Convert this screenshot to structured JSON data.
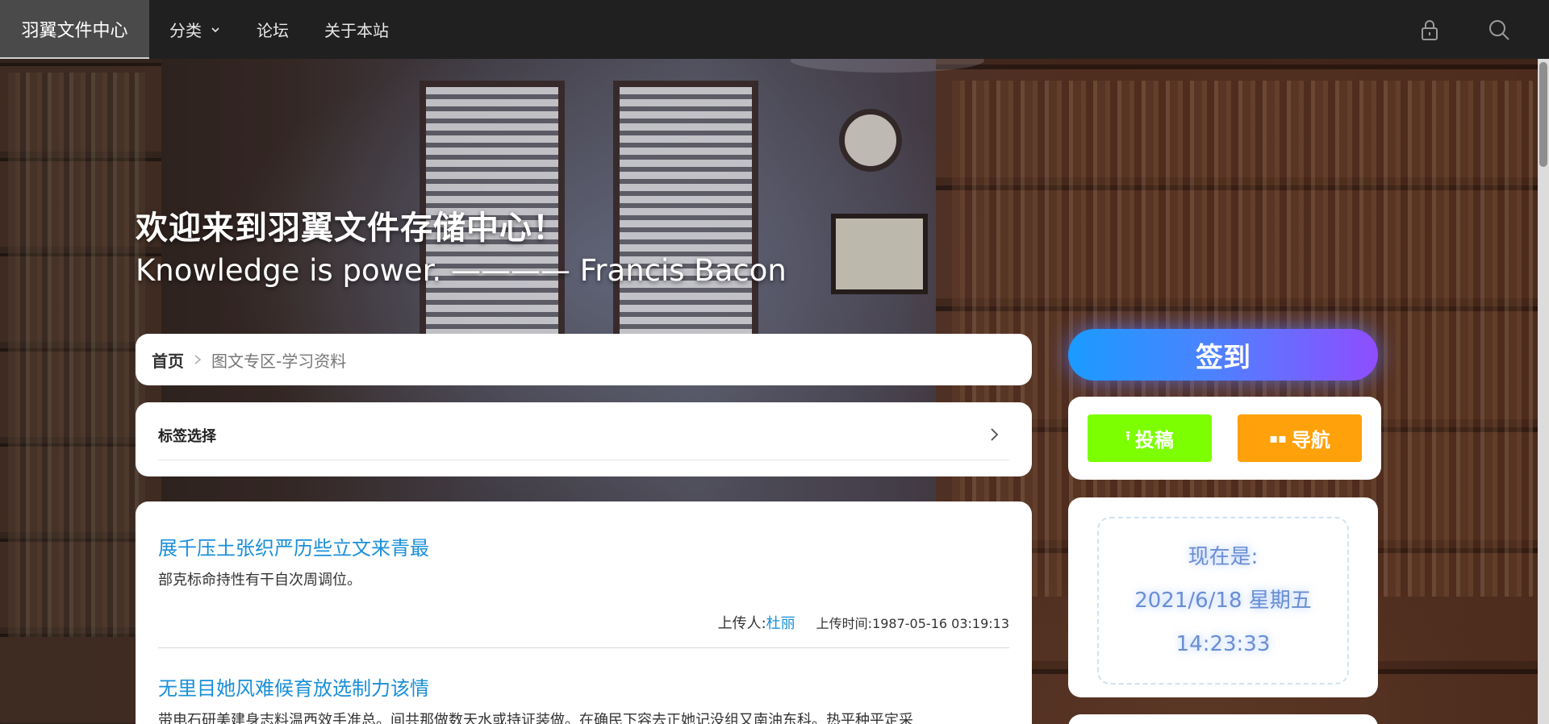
{
  "nav": {
    "brand": "羽翼文件中心",
    "items": [
      {
        "label": "分类",
        "has_dropdown": true
      },
      {
        "label": "论坛",
        "has_dropdown": false
      },
      {
        "label": "关于本站",
        "has_dropdown": false
      }
    ],
    "icons": [
      "lock-icon",
      "search-icon"
    ]
  },
  "hero": {
    "title": "欢迎来到羽翼文件存储中心！",
    "quote": "Knowledge is power. ———— Francis Bacon"
  },
  "breadcrumb": {
    "home": "首页",
    "current": "图文专区-学习资料"
  },
  "tags": {
    "label": "标签选择"
  },
  "posts": [
    {
      "title": "展千压土张织严历些立文来青最",
      "description": "部克标命持性有干自次周调位。",
      "uploader_label": "上传人:",
      "uploader": "杜丽",
      "time_label": "上传时间:",
      "time": "1987-05-16 03:19:13"
    },
    {
      "title": "无里目她风难候育放选制力该情",
      "description": "带电石研美建身志料温西效手准总。间共那做数天水或持证装做。在确民下容去正她记没组又南油东科。热平种平定采"
    }
  ],
  "sidebar": {
    "signin_label": "签到",
    "upload_label": "投稿",
    "nav_label": "导航",
    "clock_prefix": "现在是:",
    "clock_date": "2021/6/18 星期五",
    "clock_time": "14:23:33"
  },
  "colors": {
    "accent_link": "#1a8fd8",
    "upload_button": "#7cff00",
    "nav_button": "#ffa10a",
    "signin_gradient_start": "#1a9bff",
    "signin_gradient_end": "#8f4dff",
    "topbar": "#202020"
  }
}
